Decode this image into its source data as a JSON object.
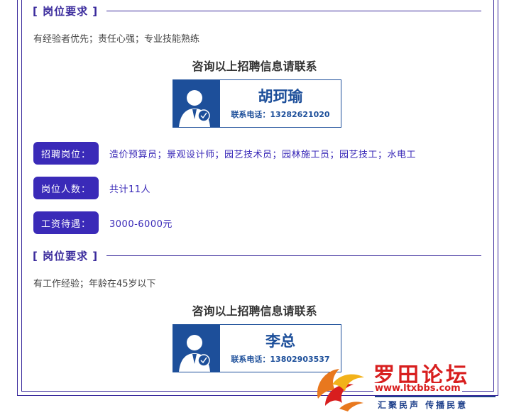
{
  "sections": [
    {
      "title": "[ 岗位要求 ]",
      "requirement": "有经验者优先；责任心强；专业技能熟练"
    },
    {
      "title": "[ 岗位要求 ]",
      "requirement": "有工作经验；年龄在45岁以下"
    }
  ],
  "consult_title": "咨询以上招聘信息请联系",
  "contacts": [
    {
      "name": "胡珂瑜",
      "phone": "联系电话：13282621020"
    },
    {
      "name": "李总",
      "phone": "联系电话：13802903537"
    }
  ],
  "job": {
    "position_label": "招聘岗位：",
    "position_value": "造价预算员；景观设计师；园艺技术员；园林施工员；园艺技工；水电工",
    "count_label": "岗位人数：",
    "count_value": "共计11人",
    "salary_label": "工资待遇：",
    "salary_value": "3000-6000元"
  },
  "watermark": {
    "title": "罗田论坛",
    "url": "www.ltxbbs.com",
    "slogan": "汇聚民声 传播民意"
  },
  "colors": {
    "accent": "#3a2ab8",
    "frame": "#3a2a9c",
    "card_blue": "#1d4f9a",
    "watermark_red": "#d81e1e"
  }
}
